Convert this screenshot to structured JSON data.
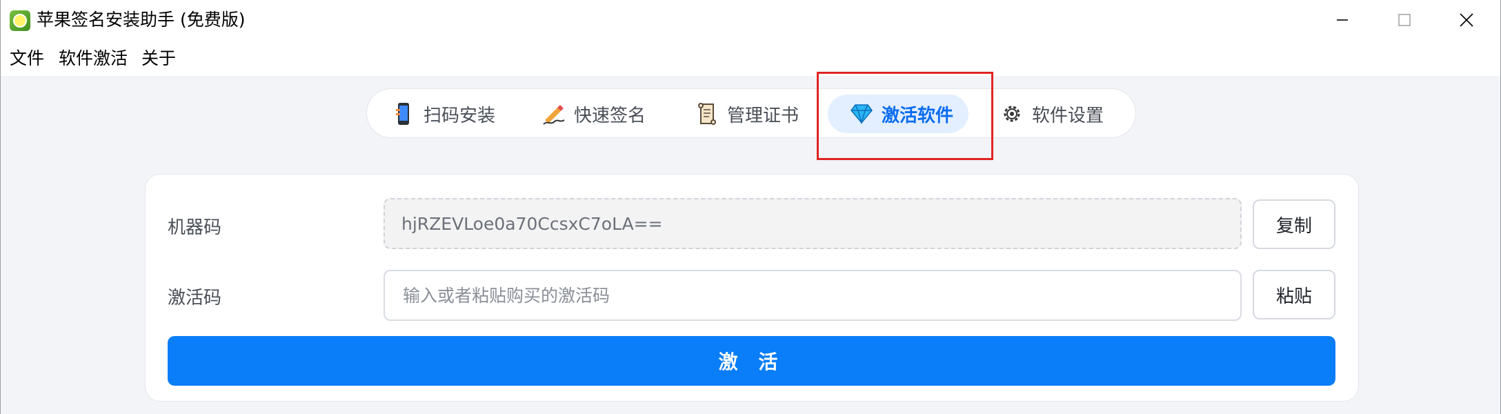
{
  "window": {
    "title": "苹果签名安装助手 (免费版)",
    "controls": {
      "minimize": "—",
      "maximize": "☐",
      "close": "✕"
    }
  },
  "menu": {
    "items": [
      "文件",
      "软件激活",
      "关于"
    ]
  },
  "tabs": [
    {
      "label": "扫码安装",
      "icon": "phone-icon",
      "active": false
    },
    {
      "label": "快速签名",
      "icon": "pen-sign-icon",
      "active": false
    },
    {
      "label": "管理证书",
      "icon": "scroll-icon",
      "active": false
    },
    {
      "label": "激活软件",
      "icon": "diamond-icon",
      "active": true
    },
    {
      "label": "软件设置",
      "icon": "gear-icon",
      "active": false
    }
  ],
  "form": {
    "machine_code_label": "机器码",
    "machine_code_value": "hjRZEVLoe0a70CcsxC7oLA==",
    "copy_label": "复制",
    "activation_code_label": "激活码",
    "activation_code_placeholder": "输入或者粘贴购买的激活码",
    "paste_label": "粘贴",
    "activate_label": "激 活"
  },
  "colors": {
    "accent": "#0a7df8",
    "active_tab_bg": "#e3efff",
    "highlight": "#e02424"
  }
}
